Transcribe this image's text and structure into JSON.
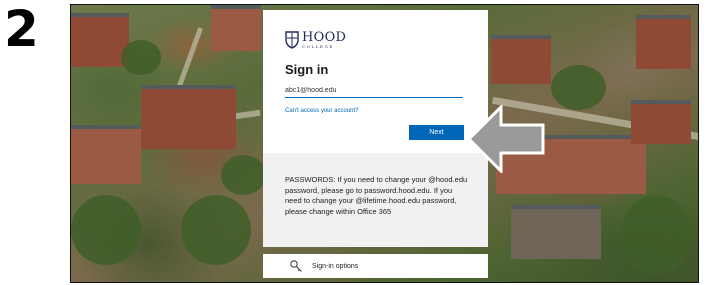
{
  "step": {
    "number": "2"
  },
  "logo": {
    "name": "HOOD",
    "subtitle": "COLLEGE"
  },
  "signin": {
    "heading": "Sign in",
    "email_value": "abc1@hood.edu",
    "cant_access_link": "Can't access your account?",
    "next_label": "Next"
  },
  "info": {
    "text": "PASSWORDS: If you need to change your @hood.edu password, please go to password.hood.edu. If you need to change your @lifetime.hood.edu password, please change within Office 365"
  },
  "signin_options": {
    "label": "Sign-in options",
    "icon": "key-icon"
  },
  "colors": {
    "accent": "#0067b8",
    "arrow": "#9a9a9a",
    "brand_navy": "#1f2a5a"
  }
}
